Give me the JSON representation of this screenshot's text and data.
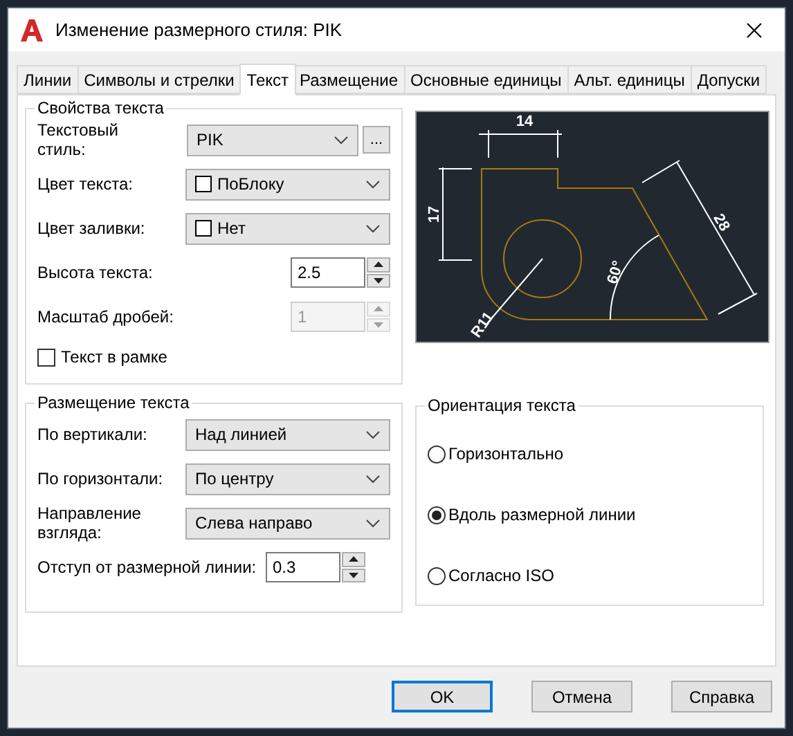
{
  "window": {
    "title": "Изменение размерного стиля: PIK"
  },
  "tabs": [
    {
      "label": "Линии",
      "selected": false
    },
    {
      "label": "Символы и стрелки",
      "selected": false
    },
    {
      "label": "Текст",
      "selected": true
    },
    {
      "label": "Размещение",
      "selected": false
    },
    {
      "label": "Основные единицы",
      "selected": false
    },
    {
      "label": "Альт. единицы",
      "selected": false
    },
    {
      "label": "Допуски",
      "selected": false
    }
  ],
  "text_properties": {
    "title": "Свойства текста",
    "fields": [
      {
        "kind": "style_combo",
        "label": "Текстовый стиль:",
        "value": "PIK",
        "button": "..."
      },
      {
        "kind": "color_combo",
        "label": "Цвет текста:",
        "value": "ПоБлоку"
      },
      {
        "kind": "color_combo",
        "label": "Цвет заливки:",
        "value": "Нет"
      },
      {
        "kind": "spinner",
        "label": "Высота текста:",
        "value": "2.5",
        "disabled": false
      },
      {
        "kind": "spinner",
        "label": "Масштаб дробей:",
        "value": "1",
        "disabled": true
      }
    ],
    "frame_checkbox": {
      "label": "Текст в рамке",
      "checked": false
    }
  },
  "preview": {
    "labels": [
      "14",
      "17",
      "28",
      "60°",
      "R11"
    ]
  },
  "text_placement": {
    "title": "Размещение текста",
    "fields": [
      {
        "kind": "combo",
        "label": "По вертикали:",
        "value": "Над линией"
      },
      {
        "kind": "combo",
        "label": "По горизонтали:",
        "value": "По центру"
      },
      {
        "kind": "combo",
        "label": "Направление взгляда:",
        "value": "Слева направо"
      },
      {
        "kind": "spinner",
        "label": "Отступ от размерной линии:",
        "value": "0.3",
        "disabled": false
      }
    ]
  },
  "text_orientation": {
    "title": "Ориентация текста",
    "options": [
      {
        "label": "Горизонтально",
        "selected": false
      },
      {
        "label": "Вдоль размерной линии",
        "selected": true
      },
      {
        "label": "Согласно ISO",
        "selected": false
      }
    ]
  },
  "buttons": [
    {
      "label": "OK",
      "default": true
    },
    {
      "label": "Отмена",
      "default": false
    },
    {
      "label": "Справка",
      "default": false
    }
  ]
}
